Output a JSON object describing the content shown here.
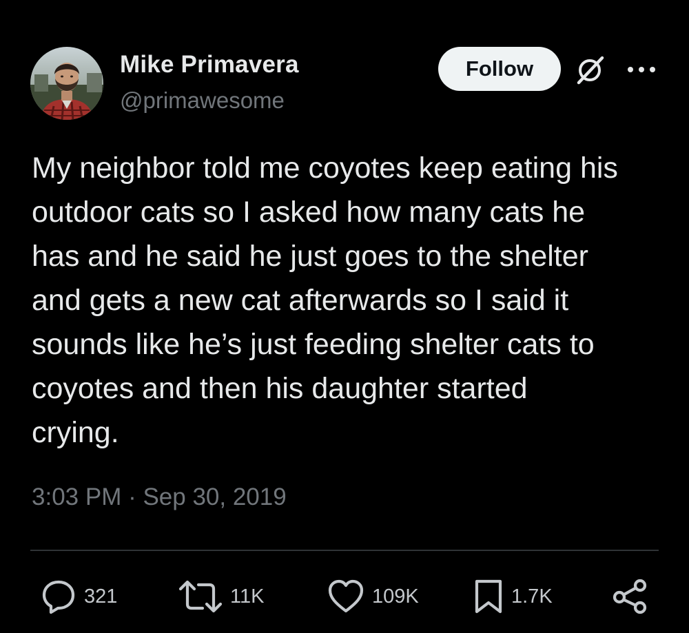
{
  "author": {
    "display_name": "Mike Primavera",
    "handle": "@primawesome",
    "avatar_icon": "profile-photo"
  },
  "header": {
    "follow_label": "Follow",
    "grok_icon": "grok-slash-icon",
    "more_icon": "more-horizontal-icon"
  },
  "tweet": {
    "lines": [
      "My neighbor told me coyotes keep eating his",
      "outdoor cats so I asked how many cats he",
      "has and he said he just goes to the shelter",
      "and gets a new cat afterwards so I said it",
      "sounds like he’s just feeding shelter cats to",
      "coyotes and then his daughter started",
      "crying."
    ],
    "timestamp": "3:03 PM · Sep 30, 2019"
  },
  "actions": {
    "replies": {
      "count": "321",
      "icon": "reply-icon"
    },
    "retweets": {
      "count": "11K",
      "icon": "retweet-icon"
    },
    "likes": {
      "count": "109K",
      "icon": "like-icon"
    },
    "bookmarks": {
      "count": "1.7K",
      "icon": "bookmark-icon"
    },
    "share": {
      "icon": "share-icon"
    }
  },
  "colors": {
    "background": "#000000",
    "text_primary": "#e7e9ea",
    "text_secondary": "#71767b",
    "follow_button_bg": "#eff3f4",
    "divider": "#2f3336"
  }
}
